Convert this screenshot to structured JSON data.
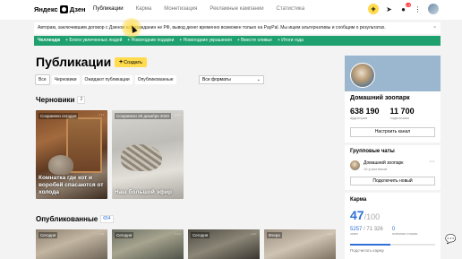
{
  "header": {
    "logo_text": "Яндекс",
    "logo_product": "Дзен",
    "nav": [
      "Публикации",
      "Карма",
      "Монетизация",
      "Рекламные кампании",
      "Статистика"
    ],
    "active_nav": "Публикации",
    "notifications_badge": "13"
  },
  "notice": {
    "text": "Авторам, заключившим договор с Дзеном как гражданин не РФ, вывод денег временно возможен только на PayPal. Мы ищем альтернативы и сообщим о результатах.",
    "close": "×"
  },
  "challenge": {
    "label": "Челлендж",
    "items": [
      "+ Блоги увлеченных людей",
      "+ Новогодние подарки",
      "+ Новогодние украшения",
      "+ Вместе оливье",
      "+ Итоги года"
    ]
  },
  "main": {
    "title": "Публикации",
    "create_label": "Создать",
    "filters": [
      "Все",
      "Черновики",
      "Ожидают публикации",
      "Опубликованные"
    ],
    "format_select": "Все форматы"
  },
  "drafts": {
    "title": "Черновики",
    "count": "2",
    "cards": [
      {
        "tag": "Сохранено сегодня",
        "title": "Комнатка где кот и воробей спасаются от холода"
      },
      {
        "tag": "Сохранено 29 декабря 2020",
        "title": "Наш большой эфир"
      }
    ]
  },
  "published": {
    "title": "Опубликованные",
    "count": "654",
    "cards": [
      {
        "tag": "Сегодня"
      },
      {
        "tag": "Сегодня"
      },
      {
        "tag": "Сегодня"
      },
      {
        "tag": "Вчера"
      }
    ]
  },
  "profile": {
    "name": "Домашний зоопарк",
    "audience": "638 190",
    "audience_label": "аудитория",
    "subscribers": "11 700",
    "subscribers_label": "подписчики",
    "settings_label": "Настроить канал"
  },
  "groups": {
    "title": "Групповые чаты",
    "group_name": "Домашний зоопарк",
    "members": "15 участников",
    "connect_label": "Подключить новый"
  },
  "karma": {
    "title": "Карма",
    "score": "47",
    "max": "/100",
    "stat1": "5257",
    "stat1_muted": "/ 71 326",
    "stat1_label": "охват",
    "stat2": "0",
    "stat2_label": "полезные отзывы",
    "progress": 0.47,
    "how_label": "Подсчитать карму"
  },
  "colors": {
    "accent": "#ffdb4d",
    "challenge": "#1fa16f",
    "link": "#2f6fd6"
  }
}
